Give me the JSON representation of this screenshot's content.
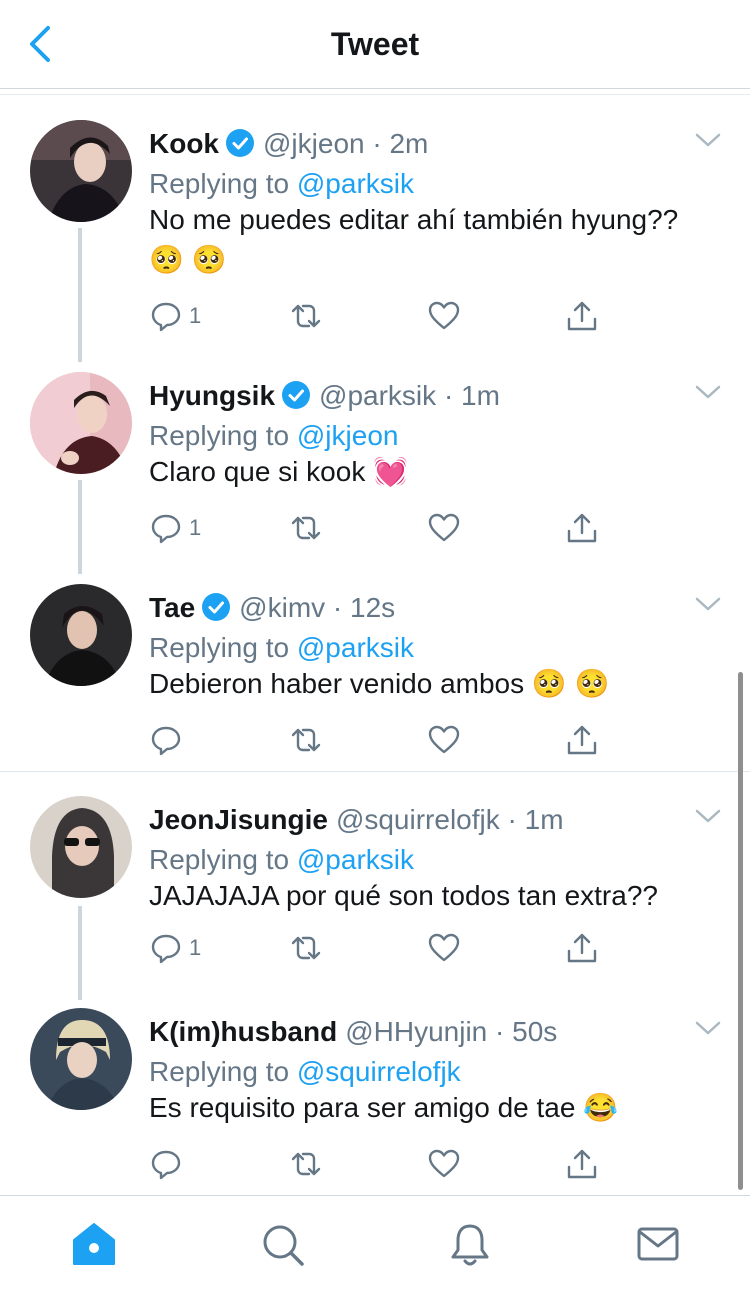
{
  "header": {
    "title": "Tweet"
  },
  "tweets": [
    {
      "name": "Kook",
      "handle": "@jkjeon",
      "dot": "·",
      "time": "2m",
      "replying_label": "Replying to",
      "replying_to": "@parksik",
      "text": "No me puedes editar ahí también hyung??🥺 🥺",
      "reply_count": "1",
      "verified": true
    },
    {
      "name": "Hyungsik",
      "handle": "@parksik",
      "dot": "·",
      "time": "1m",
      "replying_label": "Replying to",
      "replying_to": "@jkjeon",
      "text": "Claro que si kook 💓",
      "reply_count": "1",
      "verified": true
    },
    {
      "name": "Tae",
      "handle": "@kimv",
      "dot": "·",
      "time": "12s",
      "replying_label": "Replying to",
      "replying_to": "@parksik",
      "text": "Debieron haber venido ambos 🥺 🥺",
      "reply_count": "",
      "verified": true
    },
    {
      "name": "JeonJisungie",
      "handle": "@squirrelofjk",
      "dot": "·",
      "time": "1m",
      "replying_label": "Replying to",
      "replying_to": "@parksik",
      "text": "JAJAJAJA por qué son todos tan extra??",
      "reply_count": "1",
      "verified": false
    },
    {
      "name": "K(im)husband",
      "handle": "@HHyunjin",
      "dot": "·",
      "time": "50s",
      "replying_label": "Replying to",
      "replying_to": "@squirrelofjk",
      "text": "Es requisito para ser amigo de tae 😂",
      "reply_count": "",
      "verified": false
    }
  ],
  "icons": {
    "back": "chevron-left-icon",
    "verified": "verified-badge-icon",
    "more": "chevron-down-icon",
    "reply": "reply-icon",
    "retweet": "retweet-icon",
    "like": "heart-icon",
    "share": "share-icon",
    "home": "home-icon",
    "search": "search-icon",
    "notifications": "bell-icon",
    "messages": "mail-icon"
  },
  "colors": {
    "accent": "#1da1f2",
    "text": "#14171a",
    "secondary": "#657786",
    "line": "#ccd6dd"
  }
}
